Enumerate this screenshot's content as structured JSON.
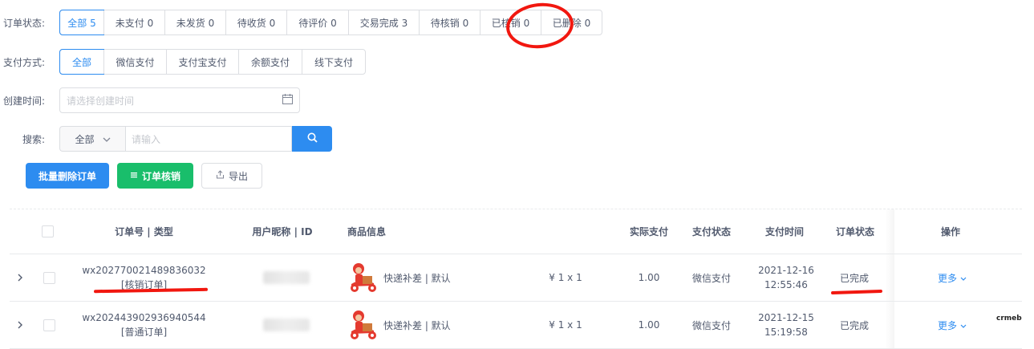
{
  "filters": {
    "order_status": {
      "label": "订单状态:",
      "options": [
        "全部 5",
        "未支付 0",
        "未发货 0",
        "待收货 0",
        "待评价 0",
        "交易完成 3",
        "待核销 0",
        "已核销 0",
        "已删除 0"
      ]
    },
    "pay_method": {
      "label": "支付方式:",
      "options": [
        "全部",
        "微信支付",
        "支付宝支付",
        "余额支付",
        "线下支付"
      ]
    },
    "create_time": {
      "label": "创建时间:",
      "placeholder": "请选择创建时间"
    },
    "search": {
      "label": "搜索:",
      "select_value": "全部",
      "placeholder": "请输入"
    }
  },
  "actions": {
    "batch_delete": "批量删除订单",
    "verify": "订单核销",
    "export": "导出"
  },
  "table": {
    "headers": {
      "order": "订单号 | 类型",
      "user": "用户昵称 | ID",
      "goods": "商品信息",
      "paid": "实际支付",
      "pay_status": "支付状态",
      "pay_time": "支付时间",
      "order_status": "订单状态",
      "ops": "操作"
    },
    "rows": [
      {
        "order_no": "wx202770021489836032",
        "type": "[核销订单]",
        "goods": "快递补差 | 默认",
        "qty": "¥ 1 x 1",
        "paid": "1.00",
        "pay_status": "微信支付",
        "date": "2021-12-16",
        "time": "12:55:46",
        "status": "已完成",
        "more": "更多"
      },
      {
        "order_no": "wx202443902936940544",
        "type": "[普通订单]",
        "goods": "快递补差 | 默认",
        "qty": "¥ 1 x 1",
        "paid": "1.00",
        "pay_status": "微信支付",
        "date": "2021-12-15",
        "time": "15:19:58",
        "status": "已完成",
        "more": "更多"
      }
    ]
  },
  "watermark": "crmeb",
  "colors": {
    "primary": "#2d8cf0",
    "success": "#19be6b",
    "annotation": "#f1170f"
  }
}
